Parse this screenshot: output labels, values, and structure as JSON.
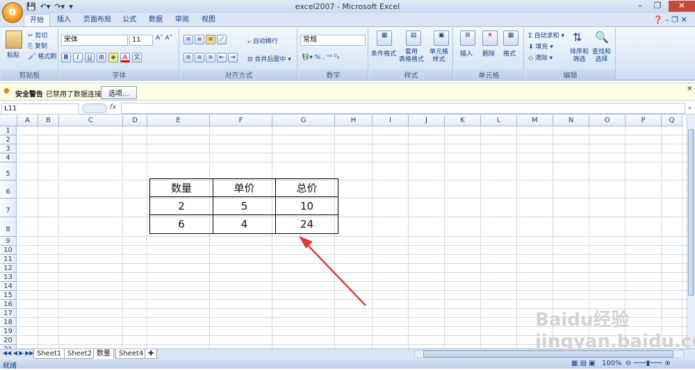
{
  "app": {
    "window_title": "excel2007 - Microsoft Excel"
  },
  "tabs": [
    "开始",
    "插入",
    "页面布局",
    "公式",
    "数据",
    "审阅",
    "视图"
  ],
  "clipboard": {
    "paste": "粘贴",
    "cut": "剪切",
    "copy": "复制",
    "format_painter": "格式刷",
    "label": "剪贴板"
  },
  "font": {
    "name": "宋体",
    "size": "11",
    "label": "字体",
    "bold": "B",
    "italic": "I",
    "underline": "U"
  },
  "alignment": {
    "wrap": "自动换行",
    "merge": "合并后居中",
    "label": "对齐方式"
  },
  "number": {
    "format": "常规",
    "label": "数字",
    "percent": "%"
  },
  "styles": {
    "cond": "条件格式",
    "table": "套用\n表格格式",
    "cell": "单元格\n样式",
    "label": "样式"
  },
  "cells": {
    "insert": "插入",
    "delete": "删除",
    "format": "格式",
    "label": "单元格"
  },
  "editing": {
    "autosum": "自动求和",
    "fill": "填充",
    "clear": "清除",
    "sort": "排序和\n筛选",
    "find": "查找和\n选择",
    "label": "编辑"
  },
  "security": {
    "title": "安全警告",
    "message": "已禁用了数据连接",
    "options": "选项..."
  },
  "formula_bar": {
    "name_box": "L11",
    "fx": "fx",
    "value": ""
  },
  "columns": [
    "A",
    "B",
    "C",
    "D",
    "E",
    "F",
    "G",
    "H",
    "I",
    "J",
    "K",
    "L",
    "M",
    "N",
    "O",
    "P",
    "Q"
  ],
  "rows": [
    "1",
    "2",
    "3",
    "4",
    "5",
    "6",
    "7",
    "8",
    "9",
    "10",
    "11",
    "12",
    "13",
    "14",
    "15",
    "16",
    "17",
    "18",
    "19",
    "20",
    "21"
  ],
  "table": {
    "headers": [
      "数量",
      "单价",
      "总价"
    ],
    "rows": [
      [
        "2",
        "5",
        "10"
      ],
      [
        "6",
        "4",
        "24"
      ]
    ]
  },
  "sheets": [
    "Sheet1",
    "Sheet2",
    "数量",
    "Sheet4"
  ],
  "active_sheet": "数量",
  "status": {
    "ready": "就绪",
    "zoom": "100%"
  },
  "watermark": "Baidu经验 jingyan.baidu.com",
  "colors": {
    "accent": "#e23a3a",
    "ribbon": "#dbe6f4"
  }
}
